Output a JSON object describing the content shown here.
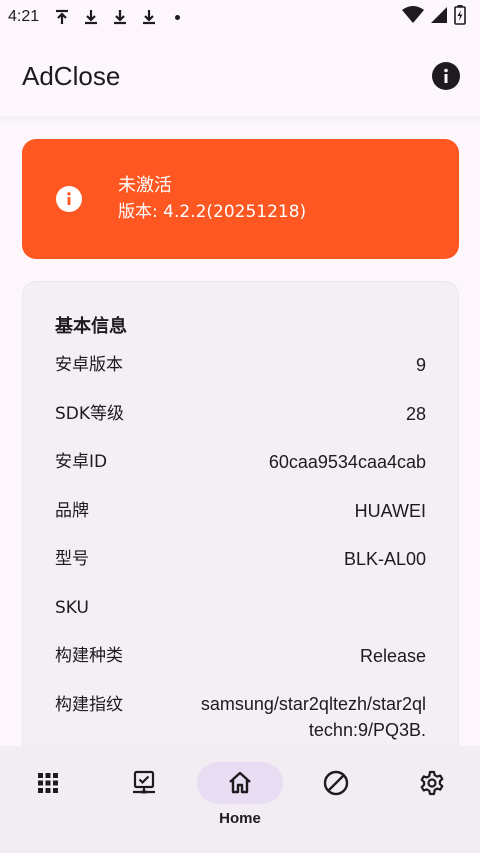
{
  "status_bar": {
    "time": "4:21",
    "icons": [
      "upload-icon",
      "download-icon",
      "download-icon",
      "download-icon",
      "notification-dot",
      "wifi-icon",
      "signal-icon",
      "battery-icon"
    ]
  },
  "app_bar": {
    "title": "AdClose",
    "info_icon": "info-icon"
  },
  "status_card": {
    "title": "未激活",
    "version": "版本: 4.2.2(20251218)",
    "background_color": "#ff5722",
    "icon": "info-icon"
  },
  "info_card": {
    "title": "基本信息",
    "rows": [
      {
        "key": "安卓版本",
        "value": "9"
      },
      {
        "key": "SDK等级",
        "value": "28"
      },
      {
        "key": "安卓ID",
        "value": "60caa9534caa4cab"
      },
      {
        "key": "品牌",
        "value": "HUAWEI"
      },
      {
        "key": "型号",
        "value": "BLK-AL00"
      },
      {
        "key": "SKU",
        "value": ""
      },
      {
        "key": "构建种类",
        "value": "Release"
      },
      {
        "key": "构建指纹",
        "value": "samsung/star2qltezh/star2qltechn:9/PQ3B."
      }
    ]
  },
  "bottom_nav": {
    "items": [
      {
        "icon": "apps-grid-icon",
        "label": ""
      },
      {
        "icon": "monitor-check-icon",
        "label": ""
      },
      {
        "icon": "home-icon",
        "label": "Home",
        "active": true
      },
      {
        "icon": "block-icon",
        "label": ""
      },
      {
        "icon": "settings-icon",
        "label": ""
      }
    ],
    "active_indicator_color": "#e9ddf4"
  }
}
